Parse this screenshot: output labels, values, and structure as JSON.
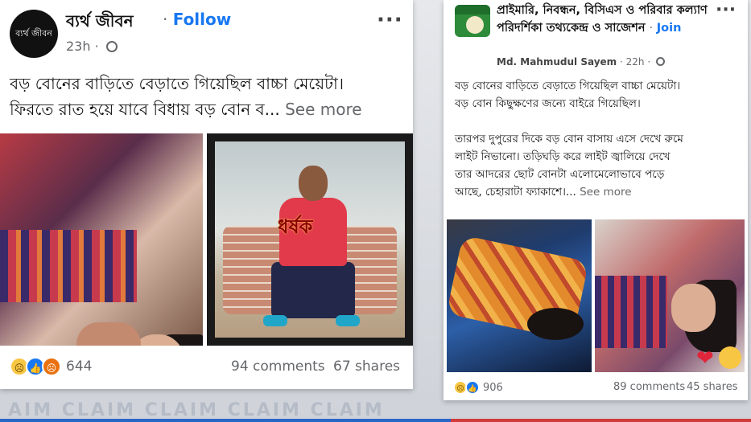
{
  "left_post": {
    "page_name": "ব্যর্থ জীবন",
    "avatar_text": "ব্যর্থ জীবন",
    "follow_label": "Follow",
    "time": "23h",
    "text_line1": "বড় বোনের বাড়িতে বেড়াতে গিয়েছিল বাচ্চা মেয়েটা।",
    "text_line2": "ফিরতে রাত হয়ে যাবে বিধায় বড় বোন ব...",
    "see_more": "See more",
    "image_overlay_word": "ধর্ষক",
    "reaction_count": "644",
    "comments": "94 comments",
    "shares": "67 shares"
  },
  "right_post": {
    "group_name": "প্রাইমারি, নিবন্ধন, বিসিএস ও পরিবার কল্যাণ পরিদর্শিকা তথ্যকেন্দ্র ও সাজেশন",
    "join_label": "Join",
    "poster_name": "Md. Mahmudul Sayem",
    "time": "22h",
    "para1_line1": "বড় বোনের বাড়িতে বেড়াতে গিয়েছিল বাচ্চা মেয়েটা।",
    "para1_line2": "বড় বোন কিছুক্ষণের জন্যে বাইরে গিয়েছিল।",
    "para2_line1": "তারপর দুপুরের দিকে বড় বোন বাসায় এসে দেখে রুমে",
    "para2_line2": "লাইট নিভানো। তড়িঘড়ি করে লাইট জ্বালিয়ে দেখে",
    "para2_line3": "তার আদরের ছোট বোনটা এলোমেলোভাবে পড়ে",
    "para2_line4": "আছে, চেহারাটা ফ্যাকাশে।...",
    "see_more": "See more",
    "reaction_count": "906",
    "comments": "89 comments",
    "shares": "45 shares"
  },
  "watermark": "AIM CLAIM CLAIM CLAIM CLAIM",
  "icons": {
    "more": "more-horizontal-icon",
    "globe": "globe-icon",
    "sad": "sad-reaction-icon",
    "like": "like-reaction-icon",
    "angry": "angry-reaction-icon"
  },
  "colors": {
    "link_blue": "#1877f2",
    "meta_gray": "#65676b"
  }
}
